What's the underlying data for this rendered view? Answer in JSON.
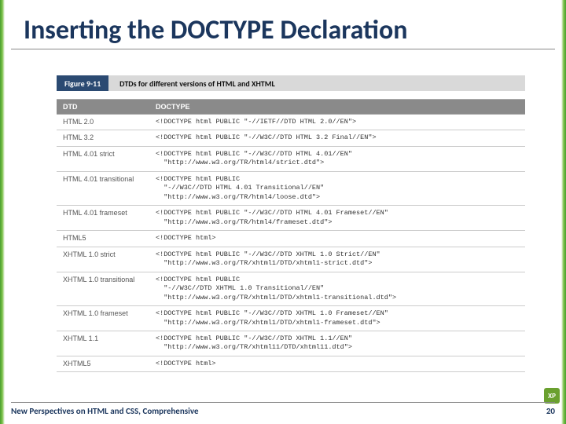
{
  "title": "Inserting the DOCTYPE Declaration",
  "figure": {
    "badge": "Figure 9-11",
    "caption": "DTDs for different versions of HTML and XHTML"
  },
  "table": {
    "headers": {
      "dtd": "DTD",
      "doctype": "DOCTYPE"
    },
    "rows": [
      {
        "dtd": "HTML 2.0",
        "doctype": "<!DOCTYPE html PUBLIC \"-//IETF//DTD HTML 2.0//EN\">"
      },
      {
        "dtd": "HTML 3.2",
        "doctype": "<!DOCTYPE html PUBLIC \"-//W3C//DTD HTML 3.2 Final//EN\">"
      },
      {
        "dtd": "HTML 4.01 strict",
        "doctype": "<!DOCTYPE html PUBLIC \"-//W3C//DTD HTML 4.01//EN\"\n  \"http://www.w3.org/TR/html4/strict.dtd\">"
      },
      {
        "dtd": "HTML 4.01 transitional",
        "doctype": "<!DOCTYPE html PUBLIC\n  \"-//W3C//DTD HTML 4.01 Transitional//EN\"\n  \"http://www.w3.org/TR/html4/loose.dtd\">"
      },
      {
        "dtd": "HTML 4.01 frameset",
        "doctype": "<!DOCTYPE html PUBLIC \"-//W3C//DTD HTML 4.01 Frameset//EN\"\n  \"http://www.w3.org/TR/html4/frameset.dtd\">"
      },
      {
        "dtd": "HTML5",
        "doctype": "<!DOCTYPE html>"
      },
      {
        "dtd": "XHTML 1.0 strict",
        "doctype": "<!DOCTYPE html PUBLIC \"-//W3C//DTD XHTML 1.0 Strict//EN\"\n  \"http://www.w3.org/TR/xhtml1/DTD/xhtml1-strict.dtd\">"
      },
      {
        "dtd": "XHTML 1.0 transitional",
        "doctype": "<!DOCTYPE html PUBLIC\n  \"-//W3C//DTD XHTML 1.0 Transitional//EN\"\n  \"http://www.w3.org/TR/xhtml1/DTD/xhtml1-transitional.dtd\">"
      },
      {
        "dtd": "XHTML 1.0 frameset",
        "doctype": "<!DOCTYPE html PUBLIC \"-//W3C//DTD XHTML 1.0 Frameset//EN\"\n  \"http://www.w3.org/TR/xhtml1/DTD/xhtml1-frameset.dtd\">"
      },
      {
        "dtd": "XHTML 1.1",
        "doctype": "<!DOCTYPE html PUBLIC \"-//W3C//DTD XHTML 1.1//EN\"\n  \"http://www.w3.org/TR/xhtml11/DTD/xhtml11.dtd\">"
      },
      {
        "dtd": "XHTML5",
        "doctype": "<!DOCTYPE html>"
      }
    ]
  },
  "footer": {
    "book": "New Perspectives on HTML and CSS, Comprehensive",
    "page": "20"
  },
  "badge": "XP"
}
